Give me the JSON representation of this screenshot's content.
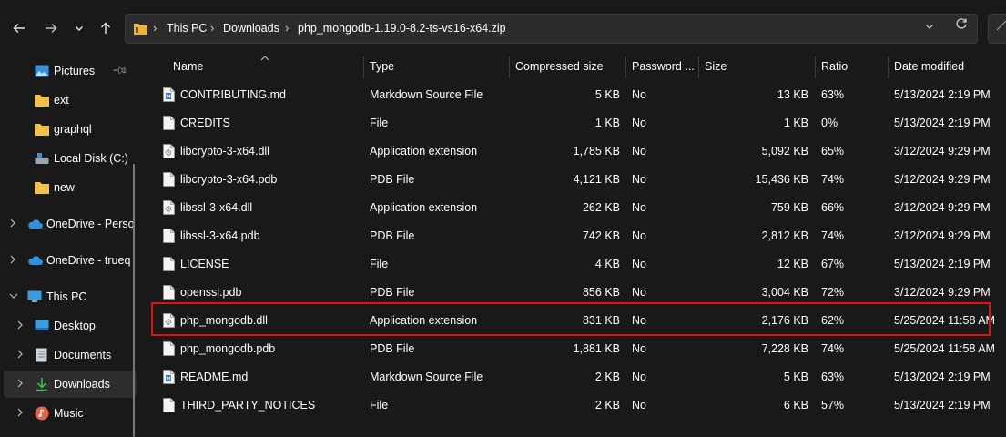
{
  "toolbar": {
    "back_icon": "arrow-left-icon",
    "forward_icon": "arrow-right-icon",
    "history_icon": "chevron-down-icon",
    "up_icon": "arrow-up-icon",
    "refresh_icon": "refresh-icon"
  },
  "address": {
    "breadcrumbs": [
      "This PC",
      "Downloads",
      "php_mongodb-1.19.0-8.2-ts-vs16-x64.zip"
    ]
  },
  "sidebar": {
    "items": [
      {
        "label": "Pictures",
        "icon": "pictures-icon"
      },
      {
        "label": "ext",
        "icon": "folder-icon"
      },
      {
        "label": "graphql",
        "icon": "folder-icon"
      },
      {
        "label": "Local Disk (C:)",
        "icon": "drive-icon"
      },
      {
        "label": "new",
        "icon": "folder-icon"
      },
      {
        "label": "OneDrive - Perso",
        "icon": "cloud-icon"
      },
      {
        "label": "OneDrive - trueq",
        "icon": "cloud-icon"
      },
      {
        "label": "This PC",
        "icon": "computer-icon"
      },
      {
        "label": "Desktop",
        "icon": "desktop-icon"
      },
      {
        "label": "Documents",
        "icon": "documents-icon"
      },
      {
        "label": "Downloads",
        "icon": "download-icon"
      },
      {
        "label": "Music",
        "icon": "music-icon"
      }
    ]
  },
  "columns": {
    "name": "Name",
    "type": "Type",
    "compressed": "Compressed size",
    "password": "Password ...",
    "size": "Size",
    "ratio": "Ratio",
    "modified": "Date modified"
  },
  "files": [
    {
      "name": "CONTRIBUTING.md",
      "type": "Markdown Source File",
      "compressed": "5 KB",
      "password": "No",
      "size": "13 KB",
      "ratio": "63%",
      "modified": "5/13/2024 2:19 PM",
      "icon": "markdown-file-icon"
    },
    {
      "name": "CREDITS",
      "type": "File",
      "compressed": "1 KB",
      "password": "No",
      "size": "1 KB",
      "ratio": "0%",
      "modified": "5/13/2024 2:19 PM",
      "icon": "file-icon"
    },
    {
      "name": "libcrypto-3-x64.dll",
      "type": "Application extension",
      "compressed": "1,785 KB",
      "password": "No",
      "size": "5,092 KB",
      "ratio": "65%",
      "modified": "3/12/2024 9:29 PM",
      "icon": "dll-icon"
    },
    {
      "name": "libcrypto-3-x64.pdb",
      "type": "PDB File",
      "compressed": "4,121 KB",
      "password": "No",
      "size": "15,436 KB",
      "ratio": "74%",
      "modified": "3/12/2024 9:29 PM",
      "icon": "file-icon"
    },
    {
      "name": "libssl-3-x64.dll",
      "type": "Application extension",
      "compressed": "262 KB",
      "password": "No",
      "size": "759 KB",
      "ratio": "66%",
      "modified": "3/12/2024 9:29 PM",
      "icon": "dll-icon"
    },
    {
      "name": "libssl-3-x64.pdb",
      "type": "PDB File",
      "compressed": "742 KB",
      "password": "No",
      "size": "2,812 KB",
      "ratio": "74%",
      "modified": "3/12/2024 9:29 PM",
      "icon": "file-icon"
    },
    {
      "name": "LICENSE",
      "type": "File",
      "compressed": "4 KB",
      "password": "No",
      "size": "12 KB",
      "ratio": "67%",
      "modified": "5/13/2024 2:19 PM",
      "icon": "file-icon"
    },
    {
      "name": "openssl.pdb",
      "type": "PDB File",
      "compressed": "856 KB",
      "password": "No",
      "size": "3,004 KB",
      "ratio": "72%",
      "modified": "3/12/2024 9:29 PM",
      "icon": "file-icon"
    },
    {
      "name": "php_mongodb.dll",
      "type": "Application extension",
      "compressed": "831 KB",
      "password": "No",
      "size": "2,176 KB",
      "ratio": "62%",
      "modified": "5/25/2024 11:58 AM",
      "icon": "dll-icon"
    },
    {
      "name": "php_mongodb.pdb",
      "type": "PDB File",
      "compressed": "1,881 KB",
      "password": "No",
      "size": "7,228 KB",
      "ratio": "74%",
      "modified": "5/25/2024 11:58 AM",
      "icon": "file-icon"
    },
    {
      "name": "README.md",
      "type": "Markdown Source File",
      "compressed": "2 KB",
      "password": "No",
      "size": "5 KB",
      "ratio": "63%",
      "modified": "5/13/2024 2:19 PM",
      "icon": "markdown-file-icon"
    },
    {
      "name": "THIRD_PARTY_NOTICES",
      "type": "File",
      "compressed": "2 KB",
      "password": "No",
      "size": "6 KB",
      "ratio": "57%",
      "modified": "5/13/2024 2:19 PM",
      "icon": "file-icon"
    }
  ],
  "colors": {
    "background": "#191919",
    "selected": "#2d2d2d",
    "highlight_box": "#e01010",
    "folder": "#f0c24a",
    "download_arrow": "#3fb950"
  }
}
